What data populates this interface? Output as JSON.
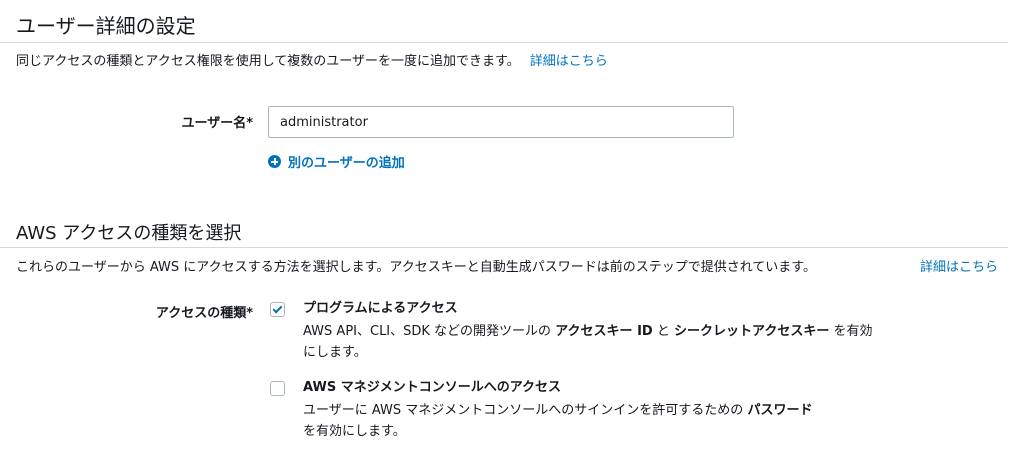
{
  "user_details": {
    "title": "ユーザー詳細の設定",
    "description": "同じアクセスの種類とアクセス権限を使用して複数のユーザーを一度に追加できます。",
    "learn_more": "詳細はこちら",
    "username_label": "ユーザー名*",
    "username_value": "administrator",
    "add_user_label": "別のユーザーの追加"
  },
  "aws_access": {
    "title": "AWS アクセスの種類を選択",
    "description": "これらのユーザーから AWS にアクセスする方法を選択します。アクセスキーと自動生成パスワードは前のステップで提供されています。",
    "learn_more": "詳細はこちら",
    "access_type_label": "アクセスの種類*",
    "options": [
      {
        "title": "プログラムによるアクセス",
        "checked": true,
        "desc_pre": "AWS API、CLI、SDK などの開発ツールの ",
        "desc_bold1": "アクセスキー ID",
        "desc_mid": " と ",
        "desc_bold2": "シークレットアクセスキー",
        "desc_post": " を有効にします。"
      },
      {
        "title": "AWS マネジメントコンソールへのアクセス",
        "checked": false,
        "desc_pre": "ユーザーに AWS マネジメントコンソールへのサインインを許可するための ",
        "desc_bold1": "パスワード",
        "desc_post": "を有効にします。"
      }
    ]
  },
  "colors": {
    "link": "#0073bb",
    "text": "#16191f",
    "divider": "#d5dbdb"
  }
}
